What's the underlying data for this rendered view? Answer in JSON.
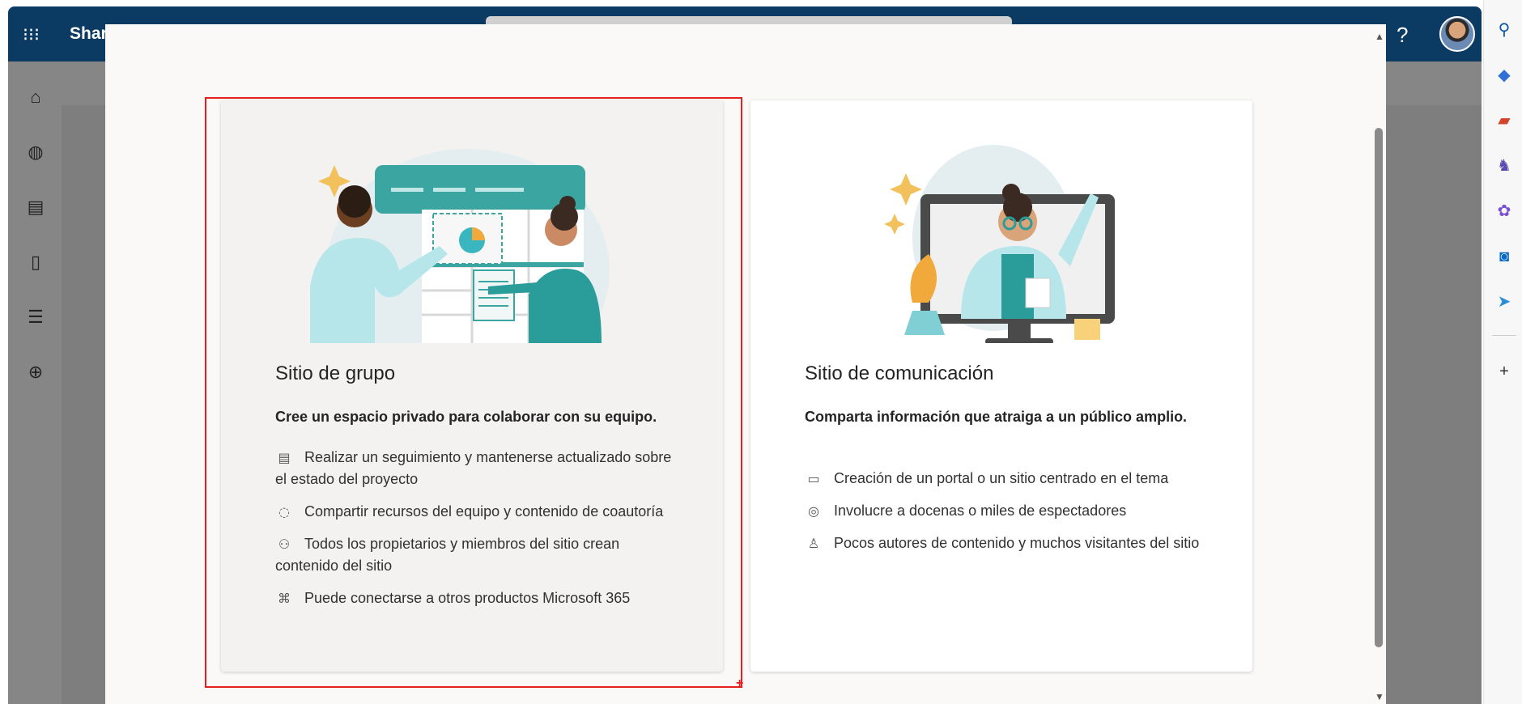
{
  "app": {
    "brand_short": "Shar"
  },
  "suite_bar": {
    "help_glyph": "?",
    "waffle_icon": "waffle-icon"
  },
  "rail": {
    "icons": [
      "home-icon",
      "globe-icon",
      "news-icon",
      "file-icon",
      "list-icon",
      "add-circle-icon"
    ]
  },
  "edge_rail": {
    "icons": [
      "search-icon",
      "tag-icon",
      "toolbox-icon",
      "chess-icon",
      "copilot-icon",
      "outlook-icon",
      "send-icon"
    ],
    "add_glyph": "+"
  },
  "modal": {
    "cards": [
      {
        "id": "team",
        "title": "Sitio de grupo",
        "subtitle": "Cree un espacio privado para colaborar con su equipo.",
        "features": [
          {
            "icon": "clipboard-icon",
            "glyph": "▤",
            "text": "Realizar un seguimiento y mantenerse actualizado sobre el estado del proyecto"
          },
          {
            "icon": "sync-icon",
            "glyph": "◌",
            "text": "Compartir recursos del equipo y contenido de coautoría"
          },
          {
            "icon": "people-network-icon",
            "glyph": "⚇",
            "text": "Todos los propietarios y miembros del sitio crean contenido del sitio"
          },
          {
            "icon": "connect-icon",
            "glyph": "⌘",
            "text": "Puede conectarse a otros productos Microsoft 365"
          }
        ]
      },
      {
        "id": "communication",
        "title": "Sitio de comunicación",
        "subtitle": "Comparta información que atraiga a un público amplio.",
        "features": [
          {
            "icon": "portal-edit-icon",
            "glyph": "▭",
            "text": "Creación de un portal o un sitio centrado en el tema"
          },
          {
            "icon": "broadcast-icon",
            "glyph": "◎",
            "text": "Involucre a docenas o miles de espectadores"
          },
          {
            "icon": "person-lock-icon",
            "glyph": "♙",
            "text": "Pocos autores de contenido y muchos visitantes del sitio"
          }
        ]
      }
    ]
  },
  "colors": {
    "suite_bar": "#0b3a63",
    "selection": "#e8201d",
    "accent_teal": "#2a9d9a"
  }
}
